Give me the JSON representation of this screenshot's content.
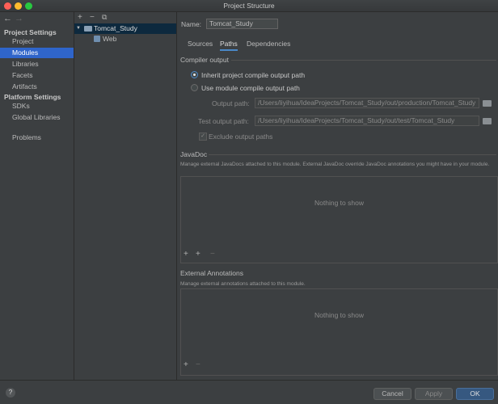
{
  "window": {
    "title": "Project Structure"
  },
  "sidebar": {
    "nav_back": "←",
    "nav_forward": "→",
    "project_settings_title": "Project Settings",
    "project_items": [
      "Project",
      "Modules",
      "Libraries",
      "Facets",
      "Artifacts"
    ],
    "platform_settings_title": "Platform Settings",
    "platform_items": [
      "SDKs",
      "Global Libraries"
    ],
    "problems": "Problems",
    "selected": "Modules"
  },
  "module_panel": {
    "add": "+",
    "remove": "−",
    "copy": "⧉",
    "tree_root": "Tomcat_Study",
    "tree_child": "Web",
    "expand_arrow": "▼"
  },
  "main": {
    "name_label": "Name:",
    "name_value": "Tomcat_Study",
    "tabs": [
      "Sources",
      "Paths",
      "Dependencies"
    ],
    "active_tab": "Paths",
    "compiler_output": {
      "header": "Compiler output",
      "inherit": "Inherit project compile output path",
      "use_module": "Use module compile output path",
      "output_path_label": "Output path:",
      "output_path": "/Users/liyihua/IdeaProjects/Tomcat_Study/out/production/Tomcat_Study",
      "test_output_path_label": "Test output path:",
      "test_output_path": "/Users/liyihua/IdeaProjects/Tomcat_Study/out/test/Tomcat_Study",
      "exclude": "Exclude output paths",
      "check_mark": "✓"
    },
    "javadoc": {
      "header": "JavaDoc",
      "description": "Manage external JavaDocs attached to this module. External JavaDoc override JavaDoc annotations you might have in your module.",
      "empty": "Nothing to show",
      "add": "+",
      "add_url": "+",
      "remove": "−"
    },
    "external_annotations": {
      "header": "External Annotations",
      "description": "Manage external annotations attached to this module.",
      "empty": "Nothing to show",
      "add": "+",
      "remove": "−"
    }
  },
  "footer": {
    "help": "?",
    "cancel": "Cancel",
    "apply": "Apply",
    "ok": "OK"
  }
}
